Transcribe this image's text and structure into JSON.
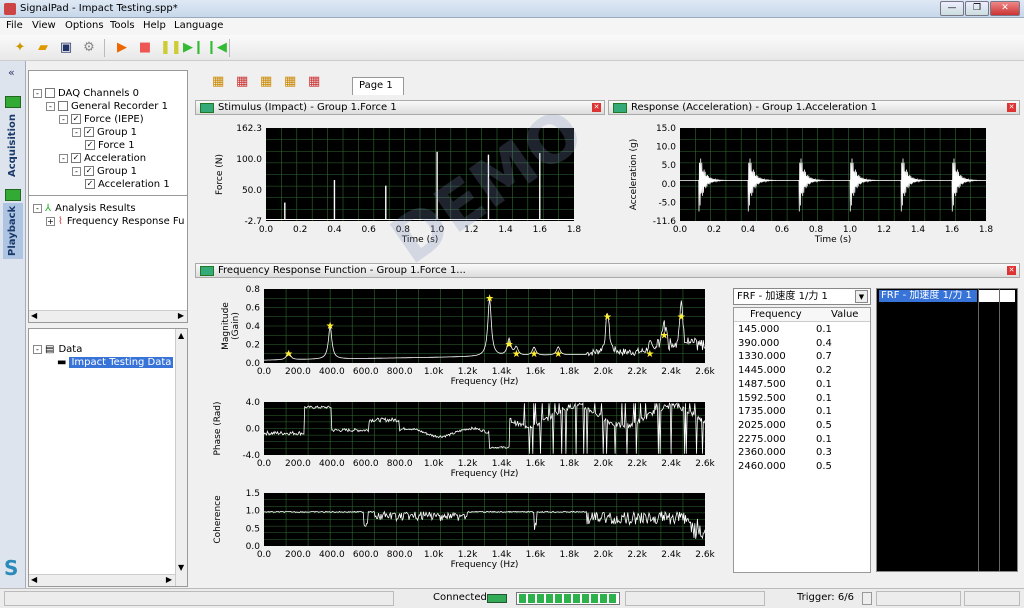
{
  "window": {
    "title": "SignalPad - Impact Testing.spp*"
  },
  "menu": [
    "File",
    "View",
    "Options",
    "Tools",
    "Help",
    "Language"
  ],
  "sidetabs": [
    "Acquisition",
    "Playback"
  ],
  "tree1": [
    {
      "label": "DAQ Channels 0",
      "level": 0,
      "toggle": "-",
      "check": ""
    },
    {
      "label": "General Recorder  1",
      "level": 1,
      "toggle": "-",
      "check": ""
    },
    {
      "label": "Force (IEPE)",
      "level": 2,
      "toggle": "-",
      "check": "✓"
    },
    {
      "label": "Group 1",
      "level": 3,
      "toggle": "-",
      "check": "✓"
    },
    {
      "label": "Force 1",
      "level": 4,
      "toggle": "",
      "check": "✓"
    },
    {
      "label": "Acceleration",
      "level": 2,
      "toggle": "-",
      "check": "✓"
    },
    {
      "label": "Group 1",
      "level": 3,
      "toggle": "-",
      "check": "✓"
    },
    {
      "label": "Acceleration 1",
      "level": 4,
      "toggle": "",
      "check": "✓"
    }
  ],
  "analysis": {
    "root": "Analysis Results",
    "child": "Frequency Response Fu"
  },
  "tree2": {
    "root": "Data",
    "child": "Impact Testing Data"
  },
  "page_tab": "Page  1",
  "panes": {
    "stimulus": "Stimulus (Impact) - Group 1.Force 1",
    "response": "Response (Acceleration) - Group 1.Acceleration 1",
    "frf": "Frequency Response Function - Group 1.Force 1..."
  },
  "plots": {
    "stim": {
      "ylabel": "Force (N)",
      "xlabel": "Time (s)",
      "yticks": [
        "162.3",
        "100.0",
        "50.0",
        "-2.7"
      ],
      "xticks": [
        "0.0",
        "0.2",
        "0.4",
        "0.6",
        "0.8",
        "1.0",
        "1.2",
        "1.4",
        "1.6",
        "1.8"
      ]
    },
    "resp": {
      "ylabel": "Acceleration (g)",
      "xlabel": "Time (s)",
      "yticks": [
        "15.0",
        "10.0",
        "5.0",
        "0.0",
        "-5.0",
        "-11.6"
      ],
      "xticks": [
        "0.0",
        "0.2",
        "0.4",
        "0.6",
        "0.8",
        "1.0",
        "1.2",
        "1.4",
        "1.6",
        "1.8"
      ]
    },
    "mag": {
      "ylabel": "Magnitude",
      "ylabel2": "(Gain)",
      "xlabel": "Frequency (Hz)",
      "yticks": [
        "0.8",
        "0.6",
        "0.4",
        "0.2",
        "0.0"
      ]
    },
    "phase": {
      "ylabel": "Phase (Rad)",
      "xlabel": "Frequency (Hz)",
      "yticks": [
        "4.0",
        "0.0",
        "-4.0"
      ]
    },
    "coh": {
      "ylabel": "Coherence",
      "xlabel": "Frequency (Hz)",
      "yticks": [
        "1.5",
        "1.0",
        "0.5",
        "0.0"
      ]
    },
    "fticks": [
      "0.0",
      "200.0",
      "400.0",
      "600.0",
      "800.0",
      "1.0k",
      "1.2k",
      "1.4k",
      "1.6k",
      "1.8k",
      "2.0k",
      "2.2k",
      "2.4k",
      "2.6k"
    ]
  },
  "frf_select": "FRF - 加速度 1/力 1",
  "frf_highlight": "FRF - 加速度 1/力 1",
  "table": {
    "headers": [
      "Frequency",
      "Value"
    ],
    "rows": [
      [
        "145.000",
        "0.1"
      ],
      [
        "390.000",
        "0.4"
      ],
      [
        "1330.000",
        "0.7"
      ],
      [
        "1445.000",
        "0.2"
      ],
      [
        "1487.500",
        "0.1"
      ],
      [
        "1592.500",
        "0.1"
      ],
      [
        "1735.000",
        "0.1"
      ],
      [
        "2025.000",
        "0.5"
      ],
      [
        "2275.000",
        "0.1"
      ],
      [
        "2360.000",
        "0.3"
      ],
      [
        "2460.000",
        "0.5"
      ]
    ]
  },
  "status": {
    "connected": "Connected",
    "trigger": "Trigger: 6/6"
  },
  "colors": {
    "plot_bg": "#000000",
    "grid": "#2f6a2f",
    "trace": "#ffffff",
    "peak": "#ffee33"
  }
}
